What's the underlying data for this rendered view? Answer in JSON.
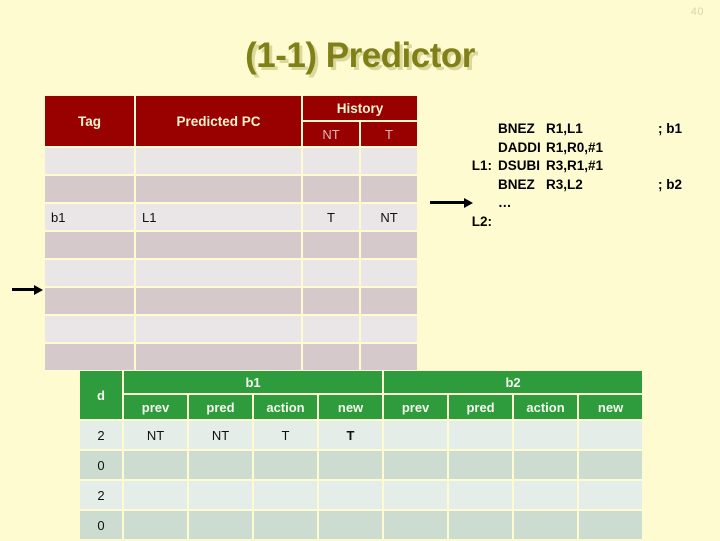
{
  "slide": {
    "page_number": "40",
    "title": "(1-1) Predictor",
    "background_color": "#FDFBCF",
    "title_color": "#808019",
    "title_shadow_color": "#DCD79B"
  },
  "btb_table": {
    "accent_color": "#990000",
    "headers": {
      "tag": "Tag",
      "predicted_pc": "Predicted PC",
      "history": "History",
      "history_nt": "NT",
      "history_t": "T"
    },
    "rows": [
      {
        "tag": "",
        "predicted_pc": "",
        "nt": "",
        "t": ""
      },
      {
        "tag": "",
        "predicted_pc": "",
        "nt": "",
        "t": ""
      },
      {
        "tag": "b1",
        "predicted_pc": "L1",
        "nt": "T",
        "t": "NT"
      },
      {
        "tag": "",
        "predicted_pc": "",
        "nt": "",
        "t": ""
      },
      {
        "tag": "",
        "predicted_pc": "",
        "nt": "",
        "t": ""
      },
      {
        "tag": "",
        "predicted_pc": "",
        "nt": "",
        "t": ""
      },
      {
        "tag": "",
        "predicted_pc": "",
        "nt": "",
        "t": ""
      },
      {
        "tag": "",
        "predicted_pc": "",
        "nt": "",
        "t": ""
      }
    ]
  },
  "code": {
    "lines": [
      {
        "label": "",
        "mnemonic": "BNEZ",
        "operands": "R1,L1",
        "comment": "; b1"
      },
      {
        "label": "",
        "mnemonic": "DADDI",
        "operands": "R1,R0,#1",
        "comment": ""
      },
      {
        "label": "L1:",
        "mnemonic": "DSUBI",
        "operands": "R3,R1,#1",
        "comment": ""
      },
      {
        "label": "",
        "mnemonic": "BNEZ",
        "operands": "R3,L2",
        "comment": "; b2"
      },
      {
        "label": "",
        "mnemonic": "…",
        "operands": "",
        "comment": ""
      },
      {
        "label": "L2:",
        "mnemonic": "",
        "operands": "",
        "comment": ""
      }
    ]
  },
  "trace_table": {
    "accent_color": "#2E9B3D",
    "highlight_color": "#BB1111",
    "group_headers": {
      "d": "d",
      "b1": "b1",
      "b2": "b2"
    },
    "sub_headers": [
      "prev",
      "pred",
      "action",
      "new"
    ],
    "rows": [
      {
        "d": "2",
        "b1": {
          "prev": "NT",
          "pred": "NT",
          "action": "T",
          "new": "T",
          "new_highlight": true
        },
        "b2": {
          "prev": "",
          "pred": "",
          "action": "",
          "new": "",
          "new_highlight": false
        }
      },
      {
        "d": "0",
        "b1": {
          "prev": "",
          "pred": "",
          "action": "",
          "new": "",
          "new_highlight": false
        },
        "b2": {
          "prev": "",
          "pred": "",
          "action": "",
          "new": "",
          "new_highlight": false
        }
      },
      {
        "d": "2",
        "b1": {
          "prev": "",
          "pred": "",
          "action": "",
          "new": "",
          "new_highlight": false
        },
        "b2": {
          "prev": "",
          "pred": "",
          "action": "",
          "new": "",
          "new_highlight": false
        }
      },
      {
        "d": "0",
        "b1": {
          "prev": "",
          "pred": "",
          "action": "",
          "new": "",
          "new_highlight": false
        },
        "b2": {
          "prev": "",
          "pred": "",
          "action": "",
          "new": "",
          "new_highlight": false
        }
      }
    ]
  },
  "arrows": {
    "code_pointer": "right-arrow-icon",
    "table_pointer": "right-arrow-icon"
  }
}
